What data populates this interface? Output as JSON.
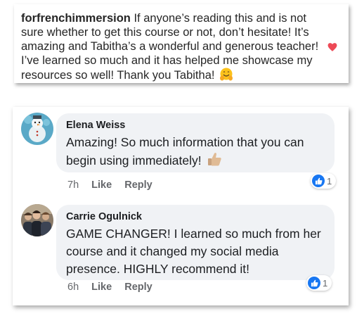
{
  "instagram_comment": {
    "username": "forfrenchimmersion",
    "text": "If anyone’s reading this and is not sure whether to get this course or not, don’t hesitate! It’s amazing and Tabitha’s a wonderful and generous teacher! I’ve learned so much and it has helped me showcase my resources so well! Thank you Tabitha!",
    "emoji": "hugging-face-emoji",
    "heart_icon": "heart-icon",
    "heart_color": "#ed4956"
  },
  "facebook_comments": [
    {
      "author": "Elena Weiss",
      "text": "Amazing! So much information that you can begin using immediately!",
      "emoji": "thumbs-up-emoji",
      "time": "7h",
      "like_label": "Like",
      "reply_label": "Reply",
      "reaction_count": "1"
    },
    {
      "author": "Carrie Ogulnick",
      "text": "GAME CHANGER! I learned so much from her course and it changed my social media presence. HIGHLY recommend it!",
      "time": "6h",
      "like_label": "Like",
      "reply_label": "Reply",
      "reaction_count": "1"
    }
  ],
  "colors": {
    "bubble_bg": "#f0f2f5",
    "like_blue": "#1877f2",
    "meta_gray": "#65676b"
  }
}
